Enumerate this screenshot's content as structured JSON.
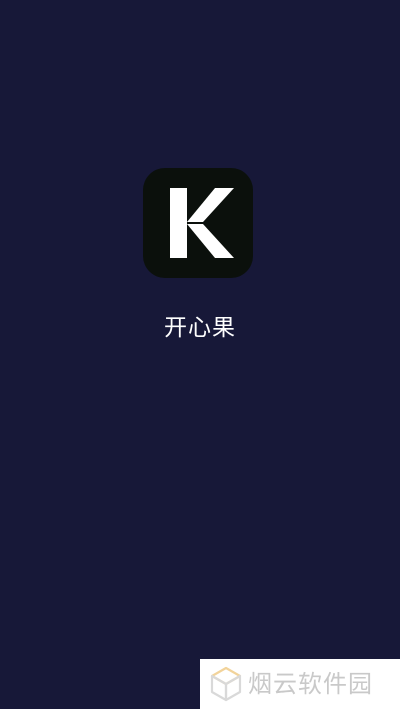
{
  "app": {
    "name": "开心果",
    "icon_letter": "K",
    "icon": "k-logo-icon"
  },
  "watermark": {
    "text": "烟云软件园",
    "icon": "cube-logo-icon"
  },
  "colors": {
    "background": "#171838",
    "icon_background": "#0b100c",
    "icon_glyph": "#ffffff",
    "app_name": "#ffffff",
    "watermark_background": "#ffffff",
    "watermark_text": "#c9c9c9",
    "watermark_logo_accent": "#f2d39a"
  }
}
